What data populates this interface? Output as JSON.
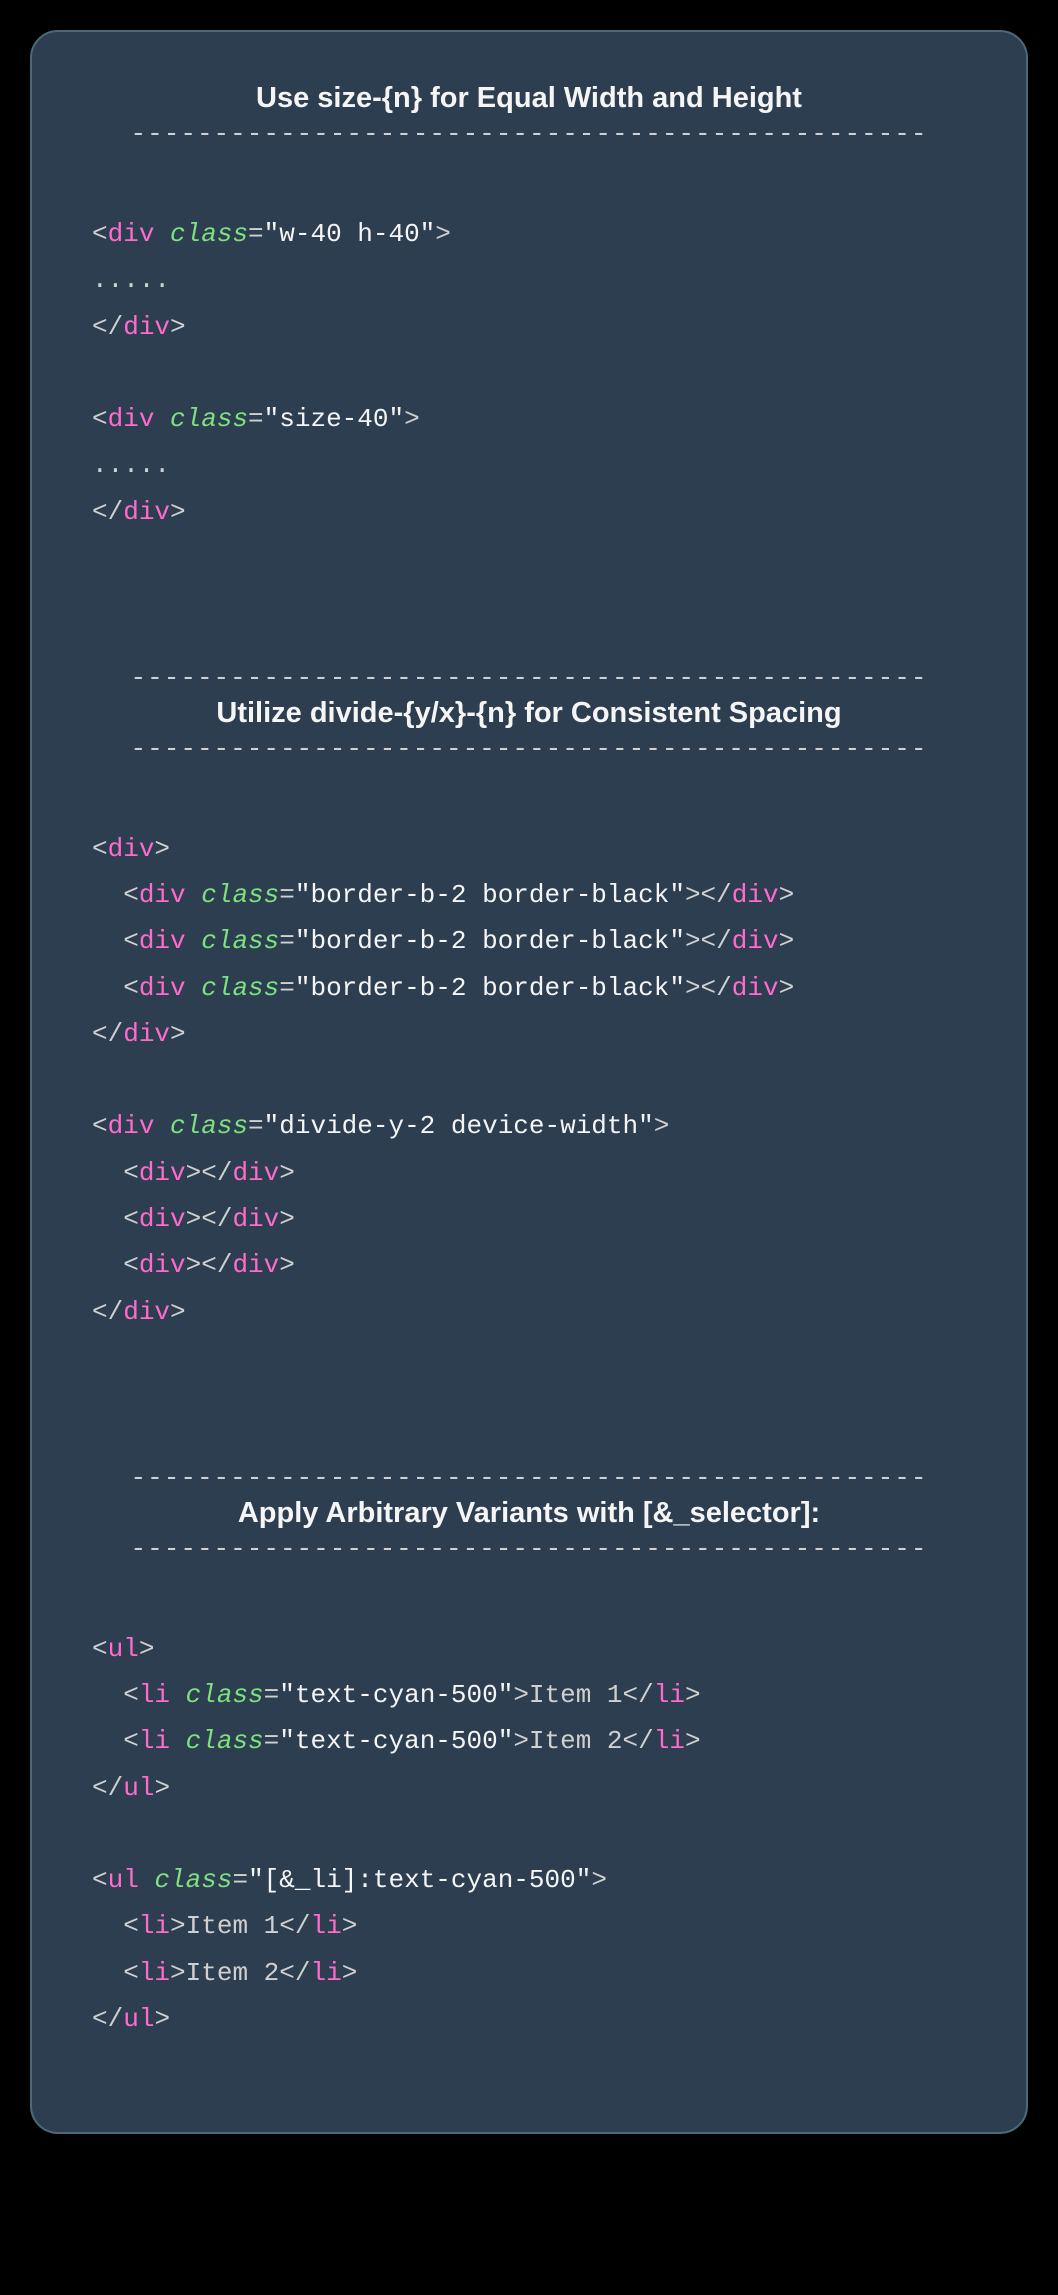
{
  "dash_line": "------------------------------------------------",
  "sections": {
    "s1": {
      "title": "Use size-{n} for Equal Width and Height",
      "code": {
        "l1a": "<",
        "l1b": "div",
        "l1c": " ",
        "l1d": "class",
        "l1e": "=",
        "l1f": "\"w-40 h-40\"",
        "l1g": ">",
        "l2a": ".....",
        "l3a": "</",
        "l3b": "div",
        "l3c": ">",
        "l4": "",
        "l5a": "<",
        "l5b": "div",
        "l5c": " ",
        "l5d": "class",
        "l5e": "=",
        "l5f": "\"size-40\"",
        "l5g": ">",
        "l6a": ".....",
        "l7a": "</",
        "l7b": "div",
        "l7c": ">"
      }
    },
    "s2": {
      "title": "Utilize divide-{y/x}-{n} for Consistent Spacing",
      "code": {
        "l1a": "<",
        "l1b": "div",
        "l1c": ">",
        "l2a": "  <",
        "l2b": "div",
        "l2c": " ",
        "l2d": "class",
        "l2e": "=",
        "l2f": "\"border-b-2 border-black\"",
        "l2g": "></",
        "l2h": "div",
        "l2i": ">",
        "l3a": "  <",
        "l3b": "div",
        "l3c": " ",
        "l3d": "class",
        "l3e": "=",
        "l3f": "\"border-b-2 border-black\"",
        "l3g": "></",
        "l3h": "div",
        "l3i": ">",
        "l4a": "  <",
        "l4b": "div",
        "l4c": " ",
        "l4d": "class",
        "l4e": "=",
        "l4f": "\"border-b-2 border-black\"",
        "l4g": "></",
        "l4h": "div",
        "l4i": ">",
        "l5a": "</",
        "l5b": "div",
        "l5c": ">",
        "l6": "",
        "l7a": "<",
        "l7b": "div",
        "l7c": " ",
        "l7d": "class",
        "l7e": "=",
        "l7f": "\"divide-y-2 device-width\"",
        "l7g": ">",
        "l8a": "  <",
        "l8b": "div",
        "l8c": "></",
        "l8d": "div",
        "l8e": ">",
        "l9a": "  <",
        "l9b": "div",
        "l9c": "></",
        "l9d": "div",
        "l9e": ">",
        "l10a": "  <",
        "l10b": "div",
        "l10c": "></",
        "l10d": "div",
        "l10e": ">",
        "l11a": "</",
        "l11b": "div",
        "l11c": ">"
      }
    },
    "s3": {
      "title": "Apply Arbitrary Variants with [&_selector]:",
      "code": {
        "l1a": "<",
        "l1b": "ul",
        "l1c": ">",
        "l2a": "  <",
        "l2b": "li",
        "l2c": " ",
        "l2d": "class",
        "l2e": "=",
        "l2f": "\"text-cyan-500\"",
        "l2g": ">",
        "l2h": "Item 1",
        "l2i": "</",
        "l2j": "li",
        "l2k": ">",
        "l3a": "  <",
        "l3b": "li",
        "l3c": " ",
        "l3d": "class",
        "l3e": "=",
        "l3f": "\"text-cyan-500\"",
        "l3g": ">",
        "l3h": "Item 2",
        "l3i": "</",
        "l3j": "li",
        "l3k": ">",
        "l4a": "</",
        "l4b": "ul",
        "l4c": ">",
        "l5": "",
        "l6a": "<",
        "l6b": "ul",
        "l6c": " ",
        "l6d": "class",
        "l6e": "=",
        "l6f": "\"[&_li]:text-cyan-500\"",
        "l6g": ">",
        "l7a": "  <",
        "l7b": "li",
        "l7c": ">",
        "l7d": "Item 1",
        "l7e": "</",
        "l7f": "li",
        "l7g": ">",
        "l8a": "  <",
        "l8b": "li",
        "l8c": ">",
        "l8d": "Item 2",
        "l8e": "</",
        "l8f": "li",
        "l8g": ">",
        "l9a": "</",
        "l9b": "ul",
        "l9c": ">"
      }
    }
  }
}
